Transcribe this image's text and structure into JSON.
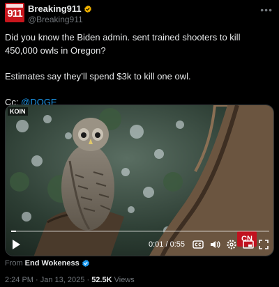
{
  "author": {
    "avatar_text": "911",
    "display_name": "Breaking911",
    "handle": "@Breaking911",
    "verified_icon": "verified-badge-gold"
  },
  "menu_icon": "more-icon",
  "tweet": {
    "line1": "Did you know the Biden admin. sent trained shooters to kill 450,000 owls in Oregon?",
    "line2": "Estimates say they’ll spend $3k to kill one owl.",
    "cc_prefix": "Cc: ",
    "mention": "@DOGE"
  },
  "video": {
    "watermark": "KOIN",
    "current_time": "0:01",
    "duration": "0:55",
    "time_display": "0:01 / 0:55",
    "progress_fraction": 0.02,
    "corner_logo": "CN",
    "controls": [
      "play-icon",
      "captions-icon",
      "volume-icon",
      "settings-icon",
      "pip-icon",
      "fullscreen-icon"
    ]
  },
  "attribution": {
    "prefix": "From",
    "source": "End Wokeness",
    "verified_icon": "verified-badge-blue"
  },
  "meta": {
    "time": "2:24 PM",
    "separator": "·",
    "date": "Jan 13, 2025",
    "views_count": "52.5K",
    "views_label": "Views"
  },
  "colors": {
    "background": "#000000",
    "text": "#e7e9ea",
    "muted": "#71767b",
    "link": "#1d9bf0",
    "brand_red": "#c8161d",
    "gold_badge": "#f4b400"
  }
}
